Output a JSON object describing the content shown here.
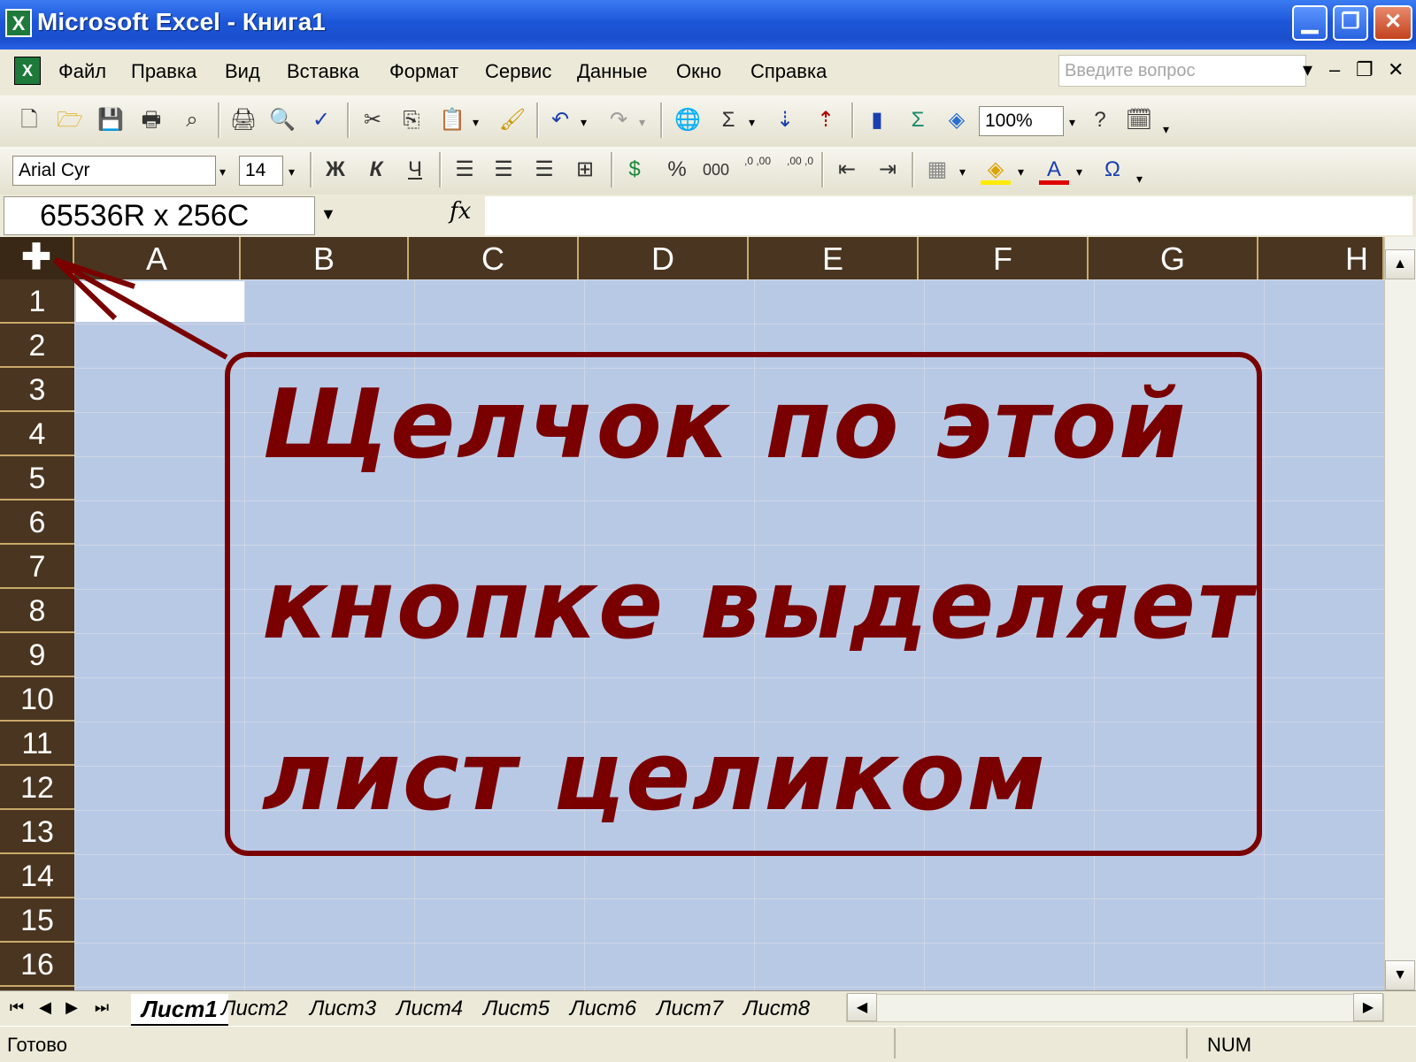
{
  "window": {
    "title": "Microsoft Excel - Книга1",
    "app_icon": "excel-icon",
    "controls": {
      "minimize": "▁",
      "maximize": "❐",
      "close": "✕"
    }
  },
  "menu": {
    "items": [
      "Файл",
      "Правка",
      "Вид",
      "Вставка",
      "Формат",
      "Сервис",
      "Данные",
      "Окно",
      "Справка"
    ],
    "help_placeholder": "Введите вопрос",
    "help_arrow": "▾",
    "doc_controls": {
      "minimize": "–",
      "restore": "❐",
      "close": "✕"
    }
  },
  "toolbar_standard": {
    "zoom": "100%",
    "icons": [
      "new-icon",
      "open-icon",
      "save-icon",
      "permission-icon",
      "search-icon",
      "print-icon",
      "print-preview-icon",
      "spelling-icon",
      "cut-icon",
      "copy-icon",
      "paste-icon",
      "format-painter-icon",
      "undo-icon",
      "redo-icon",
      "hyperlink-icon",
      "autosum-icon",
      "sort-ascending-icon",
      "sort-descending-icon",
      "chart-wizard-icon",
      "function-icon",
      "drawing-icon",
      "help-icon",
      "calendar-icon"
    ]
  },
  "toolbar_formatting": {
    "font_name": "Arial Cyr",
    "font_size": "14",
    "bold": "Ж",
    "italic": "К",
    "underline": "Ч",
    "percent": "%",
    "thousands": "000",
    "increase_decimal": ",0 ,00",
    "decrease_decimal": ",00 ,0",
    "font_color": "A",
    "symbol": "Ω"
  },
  "formula_bar": {
    "name_box": "65536R x 256C",
    "fx": "fx",
    "formula": ""
  },
  "grid": {
    "select_all_symbol": "✚",
    "columns": [
      "A",
      "B",
      "C",
      "D",
      "E",
      "F",
      "G",
      "H"
    ],
    "rows": [
      "1",
      "2",
      "3",
      "4",
      "5",
      "6",
      "7",
      "8",
      "9",
      "10",
      "11",
      "12",
      "13",
      "14",
      "15",
      "16"
    ],
    "selection_color": "#b8c9e6"
  },
  "annotation": {
    "lines": [
      "Щелчок по этой",
      "кнопке выделяет",
      "лист целиком"
    ],
    "color": "#7a0000"
  },
  "sheets": {
    "tabs": [
      "Лист1",
      "Лист2",
      "Лист3",
      "Лист4",
      "Лист5",
      "Лист6",
      "Лист7",
      "Лист8"
    ],
    "active": "Лист1",
    "nav": [
      "⏮",
      "◀",
      "▶",
      "⏭"
    ]
  },
  "status": {
    "text": "Готово",
    "num": "NUM"
  }
}
